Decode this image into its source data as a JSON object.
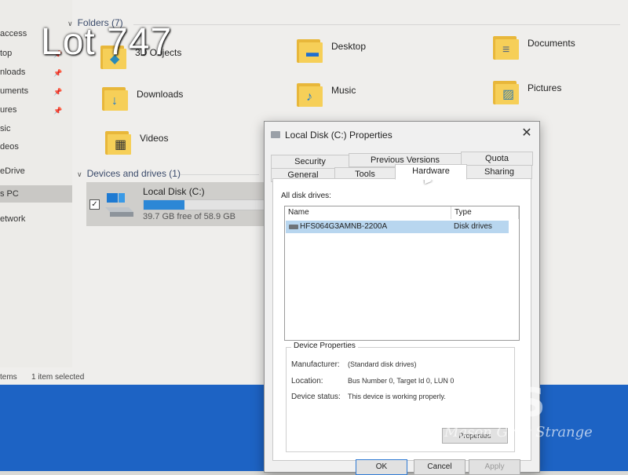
{
  "overlay": {
    "lot_label": "Lot 747"
  },
  "sidebar": {
    "items": [
      {
        "label": "access",
        "pinned": false
      },
      {
        "label": "top",
        "pinned": true
      },
      {
        "label": "nloads",
        "pinned": true
      },
      {
        "label": "uments",
        "pinned": true
      },
      {
        "label": "ures",
        "pinned": true
      },
      {
        "label": "sic",
        "pinned": false
      },
      {
        "label": "deos",
        "pinned": false
      },
      {
        "label": "eDrive",
        "pinned": false
      },
      {
        "label": "s PC",
        "pinned": false,
        "selected": true
      },
      {
        "label": "etwork",
        "pinned": false
      }
    ],
    "pin_glyph": "📌"
  },
  "folders_section": {
    "title": "Folders (7)",
    "chevron": "∨",
    "items": [
      {
        "label": "3D Objects",
        "icon": "3d-objects-icon",
        "glyph": "◆",
        "glyph_color": "#2a8ab8"
      },
      {
        "label": "Desktop",
        "icon": "desktop-folder-icon",
        "glyph": "▬",
        "glyph_color": "#1f6fd0"
      },
      {
        "label": "Documents",
        "icon": "documents-folder-icon",
        "glyph": "≡",
        "glyph_color": "#5a6b80"
      },
      {
        "label": "Downloads",
        "icon": "downloads-folder-icon",
        "glyph": "↓",
        "glyph_color": "#1e7ad2"
      },
      {
        "label": "Music",
        "icon": "music-folder-icon",
        "glyph": "♪",
        "glyph_color": "#1e7ad2"
      },
      {
        "label": "Pictures",
        "icon": "pictures-folder-icon",
        "glyph": "▨",
        "glyph_color": "#3d7fa8"
      },
      {
        "label": "Videos",
        "icon": "videos-folder-icon",
        "glyph": "▦",
        "glyph_color": "#333"
      }
    ]
  },
  "devices_section": {
    "title": "Devices and drives (1)",
    "chevron": "∨",
    "drive": {
      "name": "Local Disk (C:)",
      "free_text": "39.7 GB free of 58.9 GB",
      "used_fraction": 0.33,
      "checked": true,
      "check_glyph": "✓"
    }
  },
  "status_bar": {
    "items_text": "tems",
    "selected_text": "1 item selected"
  },
  "dialog": {
    "title": "Local Disk (C:) Properties",
    "close_glyph": "✕",
    "tabs_row1": [
      "Security",
      "Previous Versions",
      "Quota"
    ],
    "tabs_row2": [
      "General",
      "Tools",
      "Hardware",
      "Sharing"
    ],
    "active_tab": "Hardware",
    "all_disk_drives_label": "All disk drives:",
    "list": {
      "columns": [
        "Name",
        "Type"
      ],
      "rows": [
        {
          "name": "HFS064G3AMNB-2200A",
          "type": "Disk drives",
          "selected": true
        }
      ]
    },
    "device_properties": {
      "legend": "Device Properties",
      "manufacturer_label": "Manufacturer:",
      "manufacturer_value": "(Standard disk drives)",
      "location_label": "Location:",
      "location_value": "Bus Number 0, Target Id 0, LUN 0",
      "status_label": "Device status:",
      "status_value": "This device is working properly.",
      "properties_button": "Properties"
    },
    "buttons": {
      "ok": "OK",
      "cancel": "Cancel",
      "apply": "Apply"
    }
  },
  "watermark": {
    "logo": "MGS",
    "name": "Mason Gray Strange"
  },
  "colors": {
    "accent": "#2c87d6",
    "taskbar": "#1d63c4",
    "selection": "#b8d6ef"
  }
}
